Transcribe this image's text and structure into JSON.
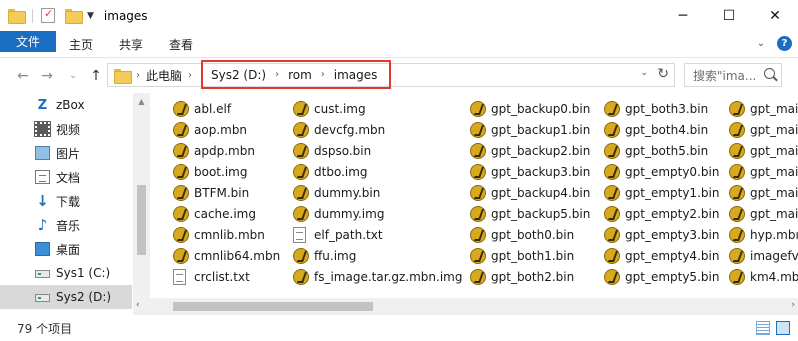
{
  "window": {
    "title": "images"
  },
  "window_buttons": {
    "minimize": "─",
    "maximize": "☐",
    "close": "✕"
  },
  "ribbon": {
    "tabs": [
      "文件",
      "主页",
      "共享",
      "查看"
    ]
  },
  "address": {
    "root": "此电脑",
    "path": [
      "Sys2 (D:)",
      "rom",
      "images"
    ],
    "highlight_color": "#e03a2f"
  },
  "search": {
    "placeholder": "搜索\"ima..."
  },
  "sidebar": {
    "items": [
      {
        "label": "zBox",
        "icon": "zbox-icon"
      },
      {
        "label": "视频",
        "icon": "video-icon"
      },
      {
        "label": "图片",
        "icon": "pictures-icon"
      },
      {
        "label": "文档",
        "icon": "documents-icon"
      },
      {
        "label": "下载",
        "icon": "downloads-icon"
      },
      {
        "label": "音乐",
        "icon": "music-icon"
      },
      {
        "label": "桌面",
        "icon": "desktop-icon"
      },
      {
        "label": "Sys1 (C:)",
        "icon": "drive-icon"
      },
      {
        "label": "Sys2 (D:)",
        "icon": "drive-icon",
        "selected": true
      }
    ]
  },
  "files": {
    "columns": [
      [
        {
          "name": "abl.elf",
          "type": "unknown"
        },
        {
          "name": "aop.mbn",
          "type": "unknown"
        },
        {
          "name": "apdp.mbn",
          "type": "unknown"
        },
        {
          "name": "boot.img",
          "type": "unknown"
        },
        {
          "name": "BTFM.bin",
          "type": "unknown"
        },
        {
          "name": "cache.img",
          "type": "unknown"
        },
        {
          "name": "cmnlib.mbn",
          "type": "unknown"
        },
        {
          "name": "cmnlib64.mbn",
          "type": "unknown"
        },
        {
          "name": "crclist.txt",
          "type": "text"
        }
      ],
      [
        {
          "name": "cust.img",
          "type": "unknown"
        },
        {
          "name": "devcfg.mbn",
          "type": "unknown"
        },
        {
          "name": "dspso.bin",
          "type": "unknown"
        },
        {
          "name": "dtbo.img",
          "type": "unknown"
        },
        {
          "name": "dummy.bin",
          "type": "unknown"
        },
        {
          "name": "dummy.img",
          "type": "unknown"
        },
        {
          "name": "elf_path.txt",
          "type": "text"
        },
        {
          "name": "ffu.img",
          "type": "unknown"
        },
        {
          "name": "fs_image.tar.gz.mbn.img",
          "type": "unknown"
        }
      ],
      [
        {
          "name": "gpt_backup0.bin",
          "type": "unknown"
        },
        {
          "name": "gpt_backup1.bin",
          "type": "unknown"
        },
        {
          "name": "gpt_backup2.bin",
          "type": "unknown"
        },
        {
          "name": "gpt_backup3.bin",
          "type": "unknown"
        },
        {
          "name": "gpt_backup4.bin",
          "type": "unknown"
        },
        {
          "name": "gpt_backup5.bin",
          "type": "unknown"
        },
        {
          "name": "gpt_both0.bin",
          "type": "unknown"
        },
        {
          "name": "gpt_both1.bin",
          "type": "unknown"
        },
        {
          "name": "gpt_both2.bin",
          "type": "unknown"
        }
      ],
      [
        {
          "name": "gpt_both3.bin",
          "type": "unknown"
        },
        {
          "name": "gpt_both4.bin",
          "type": "unknown"
        },
        {
          "name": "gpt_both5.bin",
          "type": "unknown"
        },
        {
          "name": "gpt_empty0.bin",
          "type": "unknown"
        },
        {
          "name": "gpt_empty1.bin",
          "type": "unknown"
        },
        {
          "name": "gpt_empty2.bin",
          "type": "unknown"
        },
        {
          "name": "gpt_empty3.bin",
          "type": "unknown"
        },
        {
          "name": "gpt_empty4.bin",
          "type": "unknown"
        },
        {
          "name": "gpt_empty5.bin",
          "type": "unknown"
        }
      ],
      [
        {
          "name": "gpt_mai",
          "type": "unknown"
        },
        {
          "name": "gpt_mai",
          "type": "unknown"
        },
        {
          "name": "gpt_mai",
          "type": "unknown"
        },
        {
          "name": "gpt_mai",
          "type": "unknown"
        },
        {
          "name": "gpt_mai",
          "type": "unknown"
        },
        {
          "name": "gpt_mai",
          "type": "unknown"
        },
        {
          "name": "hyp.mbı",
          "type": "unknown"
        },
        {
          "name": "imagefv",
          "type": "unknown"
        },
        {
          "name": "km4.mb",
          "type": "unknown"
        }
      ]
    ]
  },
  "status": {
    "item_count": "79 个项目"
  }
}
